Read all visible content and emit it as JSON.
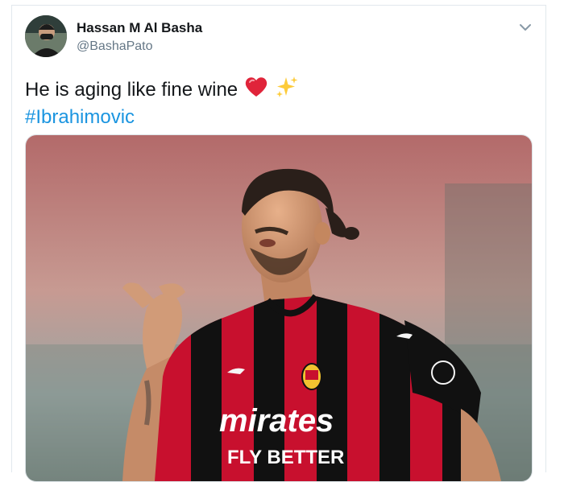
{
  "tweet": {
    "author_name": "Hassan M Al Basha",
    "author_handle": "@BashaPato",
    "text": "He is aging like fine wine",
    "emoji_heart": "heart-emoji",
    "emoji_sparkles": "sparkles-emoji",
    "hashtag": "#Ibrahimovic"
  },
  "media": {
    "jersey_sponsor_line1": "mirates",
    "jersey_sponsor_line2": "FLY BETTER",
    "colors": {
      "stripe_red": "#c8102e",
      "stripe_black": "#111111"
    }
  },
  "icons": {
    "menu": "chevron-down-icon"
  }
}
